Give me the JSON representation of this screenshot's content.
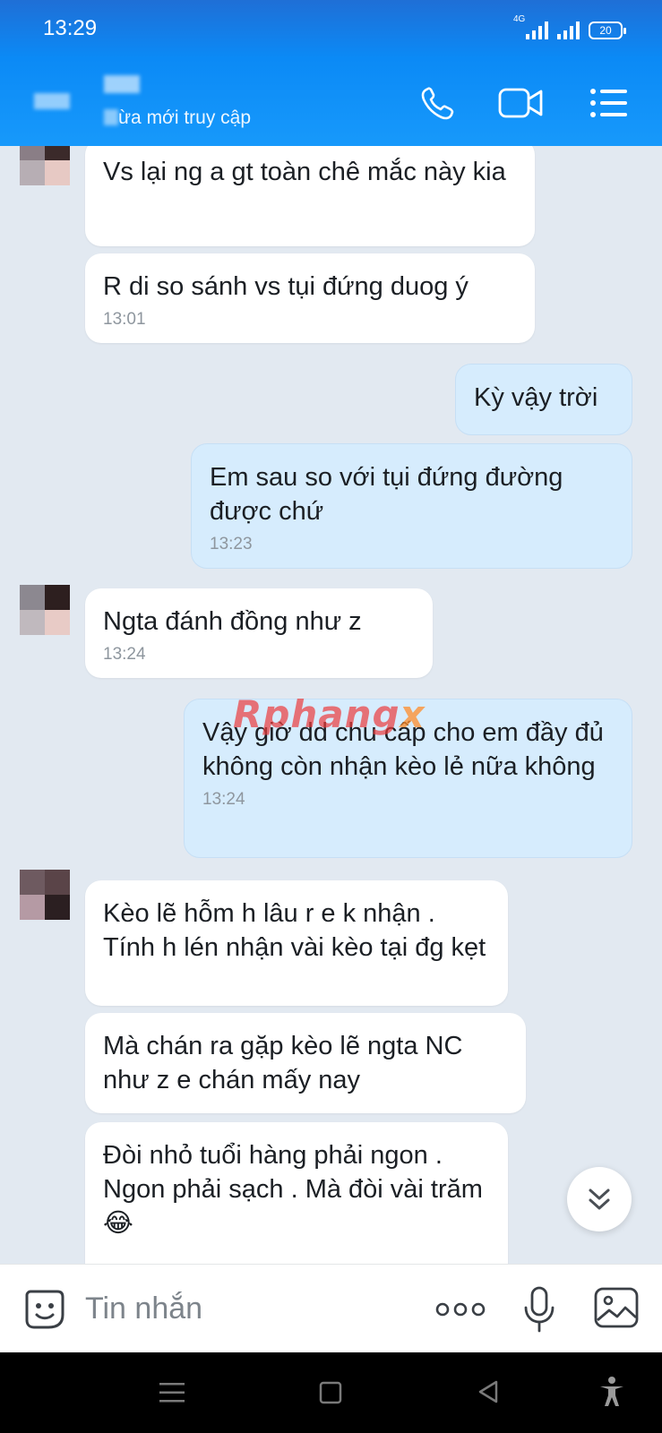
{
  "status_bar": {
    "time": "13:29",
    "network": "4G",
    "battery": "20"
  },
  "header": {
    "subtitle": "ừa mới truy cập",
    "icons": [
      "back-arrow-icon",
      "phone-icon",
      "video-call-icon",
      "menu-list-icon"
    ]
  },
  "messages": [
    {
      "side": "in",
      "text": "Vs lại ng a gt toàn chê mắc này kia"
    },
    {
      "side": "in",
      "text": "R di so sánh vs tụi đứng duog ý",
      "time": "13:01"
    },
    {
      "side": "out",
      "text": "Kỳ vậy trời"
    },
    {
      "side": "out",
      "text": " Em sau so với tụi đứng đường được chứ",
      "time": "13:23"
    },
    {
      "side": "in",
      "text": "Ngta đánh đồng  như z",
      "time": "13:24"
    },
    {
      "side": "out",
      "text": "Vậy giờ dd chu cấp cho em đầy đủ không còn nhận kèo lẻ nữa không",
      "time": "13:24"
    },
    {
      "side": "in",
      "text": "Kèo lẽ hỗm h lâu r e k nhận . Tính h lén nhận vài kèo tại đg kẹt"
    },
    {
      "side": "in",
      "text": "Mà chán ra gặp kèo lẽ ngta NC như z e chán mấy nay"
    },
    {
      "side": "in",
      "text": "Đòi nhỏ tuổi hàng phải ngon . Ngon phải sạch . Mà đòi vài trăm 😂"
    }
  ],
  "watermark": {
    "main": "Rphang",
    "tail": "x"
  },
  "input": {
    "placeholder": "Tin nhắn"
  },
  "colors": {
    "header": "#1799fb",
    "outgoing_bubble": "#d6ecfd",
    "incoming_bubble": "#ffffff",
    "background": "#e2e9f1"
  }
}
